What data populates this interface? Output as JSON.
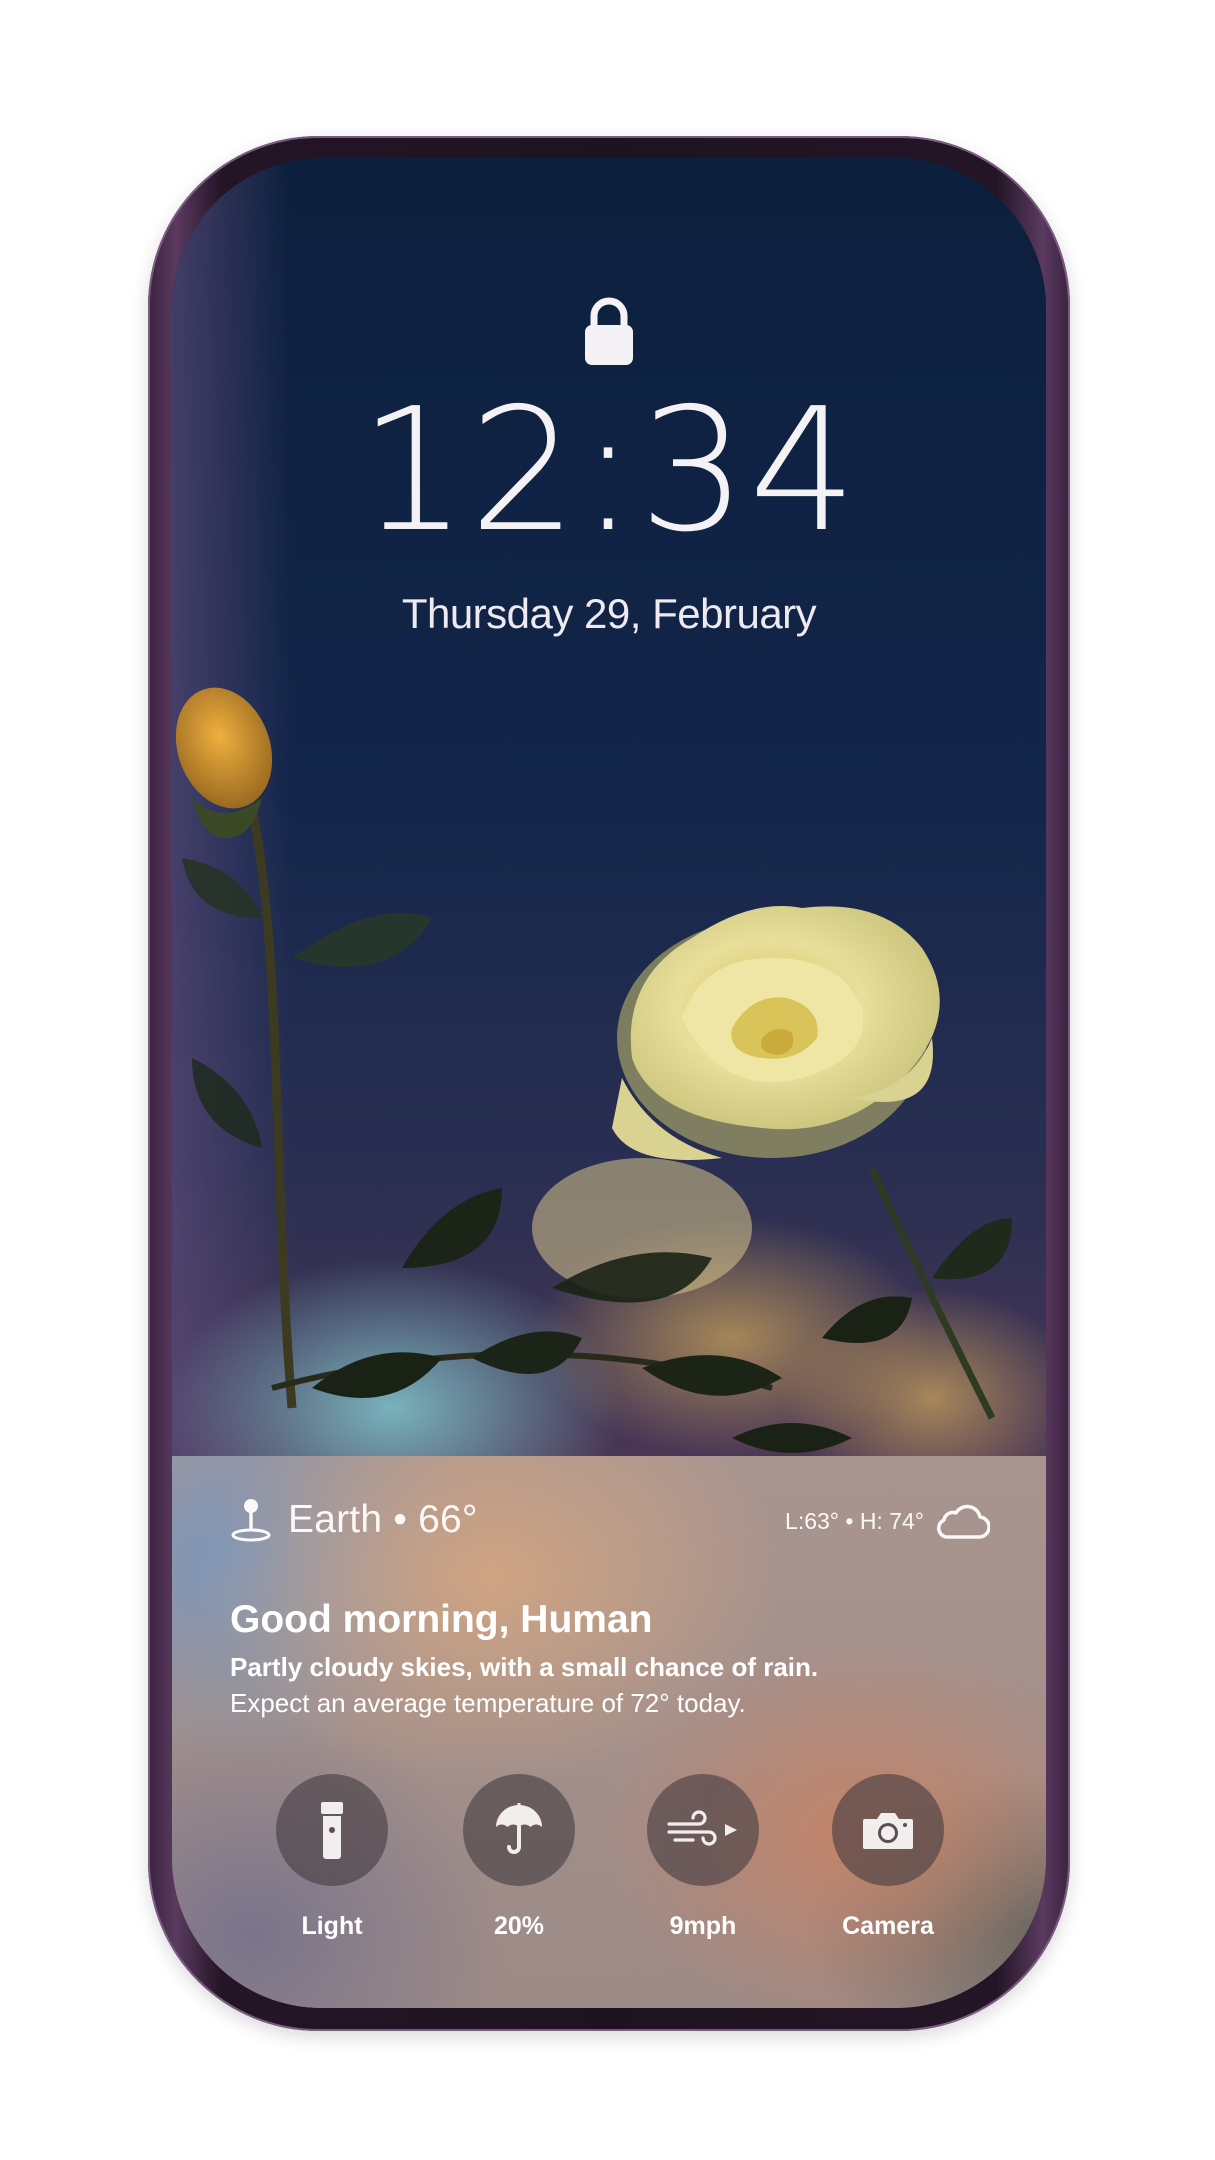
{
  "lock_screen": {
    "time": "12:34",
    "date": "Thursday 29, February"
  },
  "weather": {
    "location_line": "Earth • 66°",
    "low_high": "L:63° • H: 74°",
    "greeting": "Good morning, Human",
    "forecast": "Partly cloudy skies, with a small chance of rain.",
    "forecast_detail": "Expect an average temperature of 72° today."
  },
  "actions": {
    "light": {
      "label": "Light",
      "icon": "flashlight-icon"
    },
    "rain": {
      "label": "20%",
      "icon": "umbrella-icon"
    },
    "wind": {
      "label": "9mph",
      "icon": "wind-icon"
    },
    "camera": {
      "label": "Camera",
      "icon": "camera-icon"
    }
  },
  "colors": {
    "frame": "#2a1a2e",
    "sky": "#0e2140",
    "text": "#ffffff",
    "button_bg": "#463e42"
  }
}
